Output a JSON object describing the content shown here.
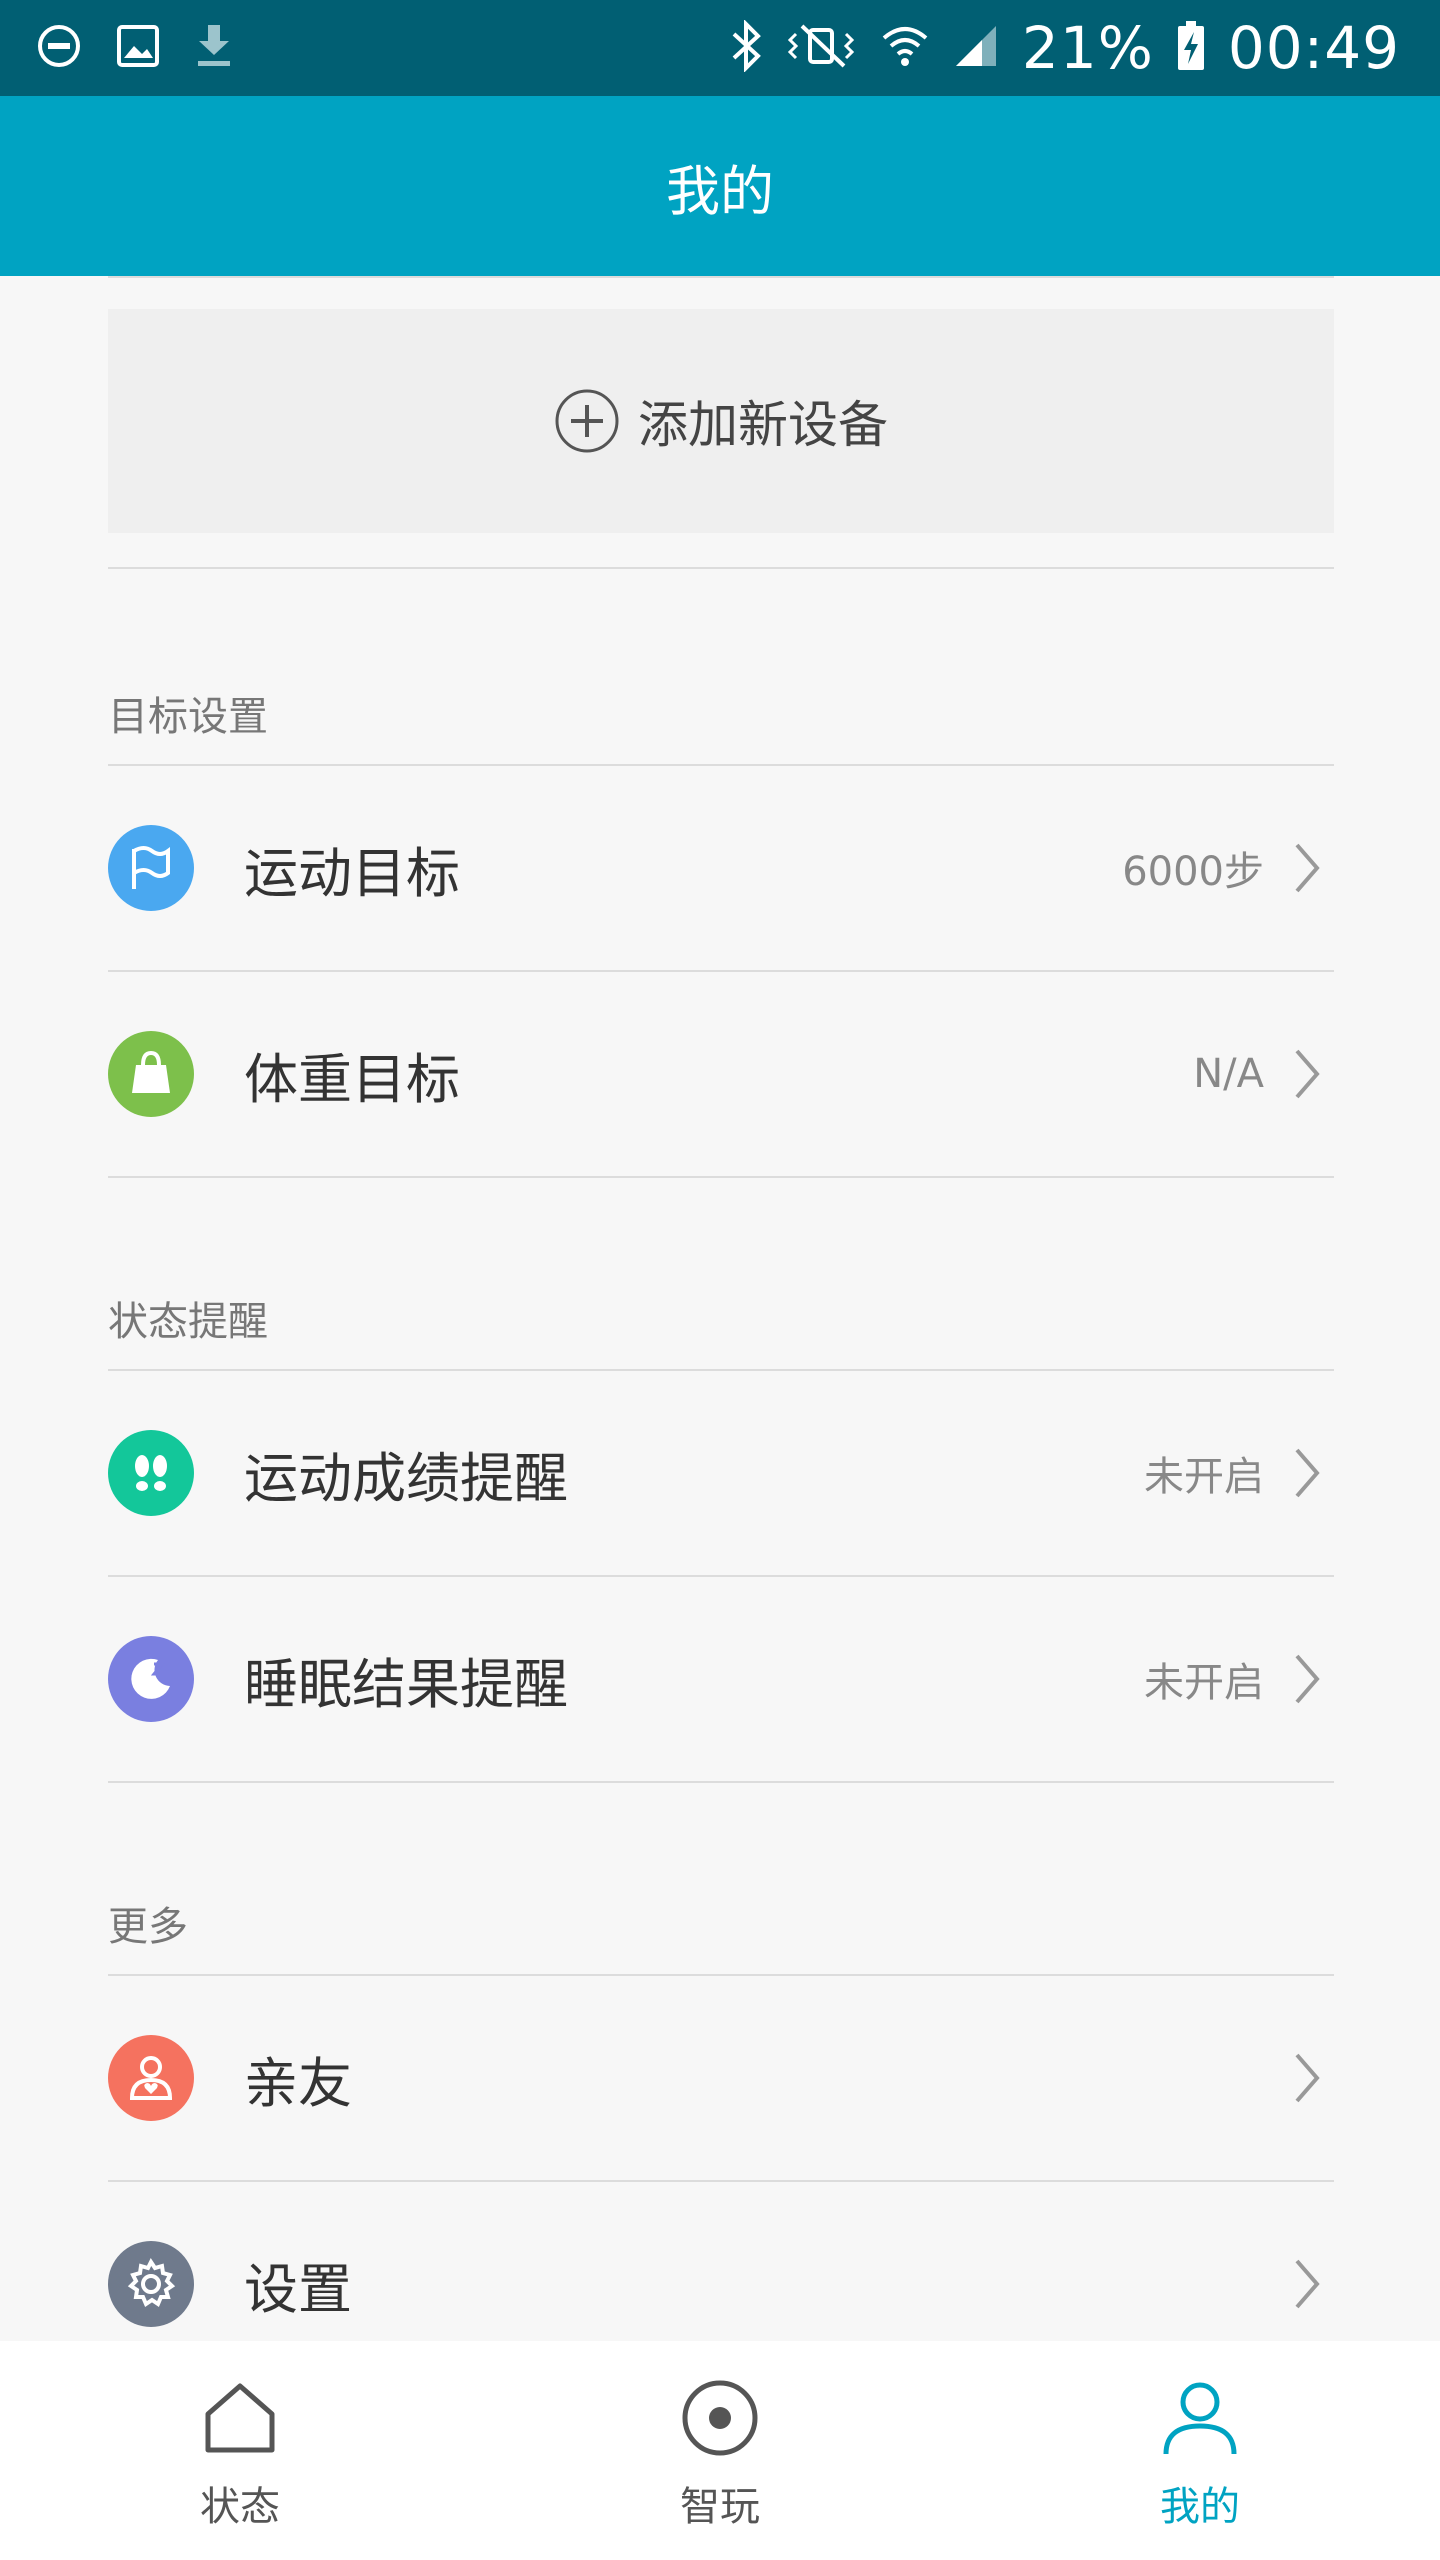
{
  "status_bar": {
    "battery": "21%",
    "time": "00:49"
  },
  "app_bar": {
    "title": "我的"
  },
  "add_device": {
    "label": "添加新设备"
  },
  "sections": {
    "goals": {
      "title": "目标设置",
      "items": [
        {
          "label": "运动目标",
          "value": "6000步",
          "icon": "flag-icon",
          "color": "#4aa8f0"
        },
        {
          "label": "体重目标",
          "value": "N/A",
          "icon": "weight-icon",
          "color": "#7dc04b"
        }
      ]
    },
    "reminders": {
      "title": "状态提醒",
      "items": [
        {
          "label": "运动成绩提醒",
          "value": "未开启",
          "icon": "footprints-icon",
          "color": "#13c79a"
        },
        {
          "label": "睡眠结果提醒",
          "value": "未开启",
          "icon": "moon-icon",
          "color": "#7a7fe0"
        }
      ]
    },
    "more": {
      "title": "更多",
      "items": [
        {
          "label": "亲友",
          "value": "",
          "icon": "friends-icon",
          "color": "#f5725f"
        },
        {
          "label": "设置",
          "value": "",
          "icon": "gear-icon",
          "color": "#6f7a8c"
        }
      ]
    }
  },
  "bottom_nav": {
    "items": [
      {
        "label": "状态",
        "icon": "home-icon"
      },
      {
        "label": "智玩",
        "icon": "play-icon"
      },
      {
        "label": "我的",
        "icon": "user-icon",
        "active": true
      }
    ]
  },
  "colors": {
    "status_bar": "#015f73",
    "accent": "#00a3c2",
    "background": "#f7f7f7"
  }
}
